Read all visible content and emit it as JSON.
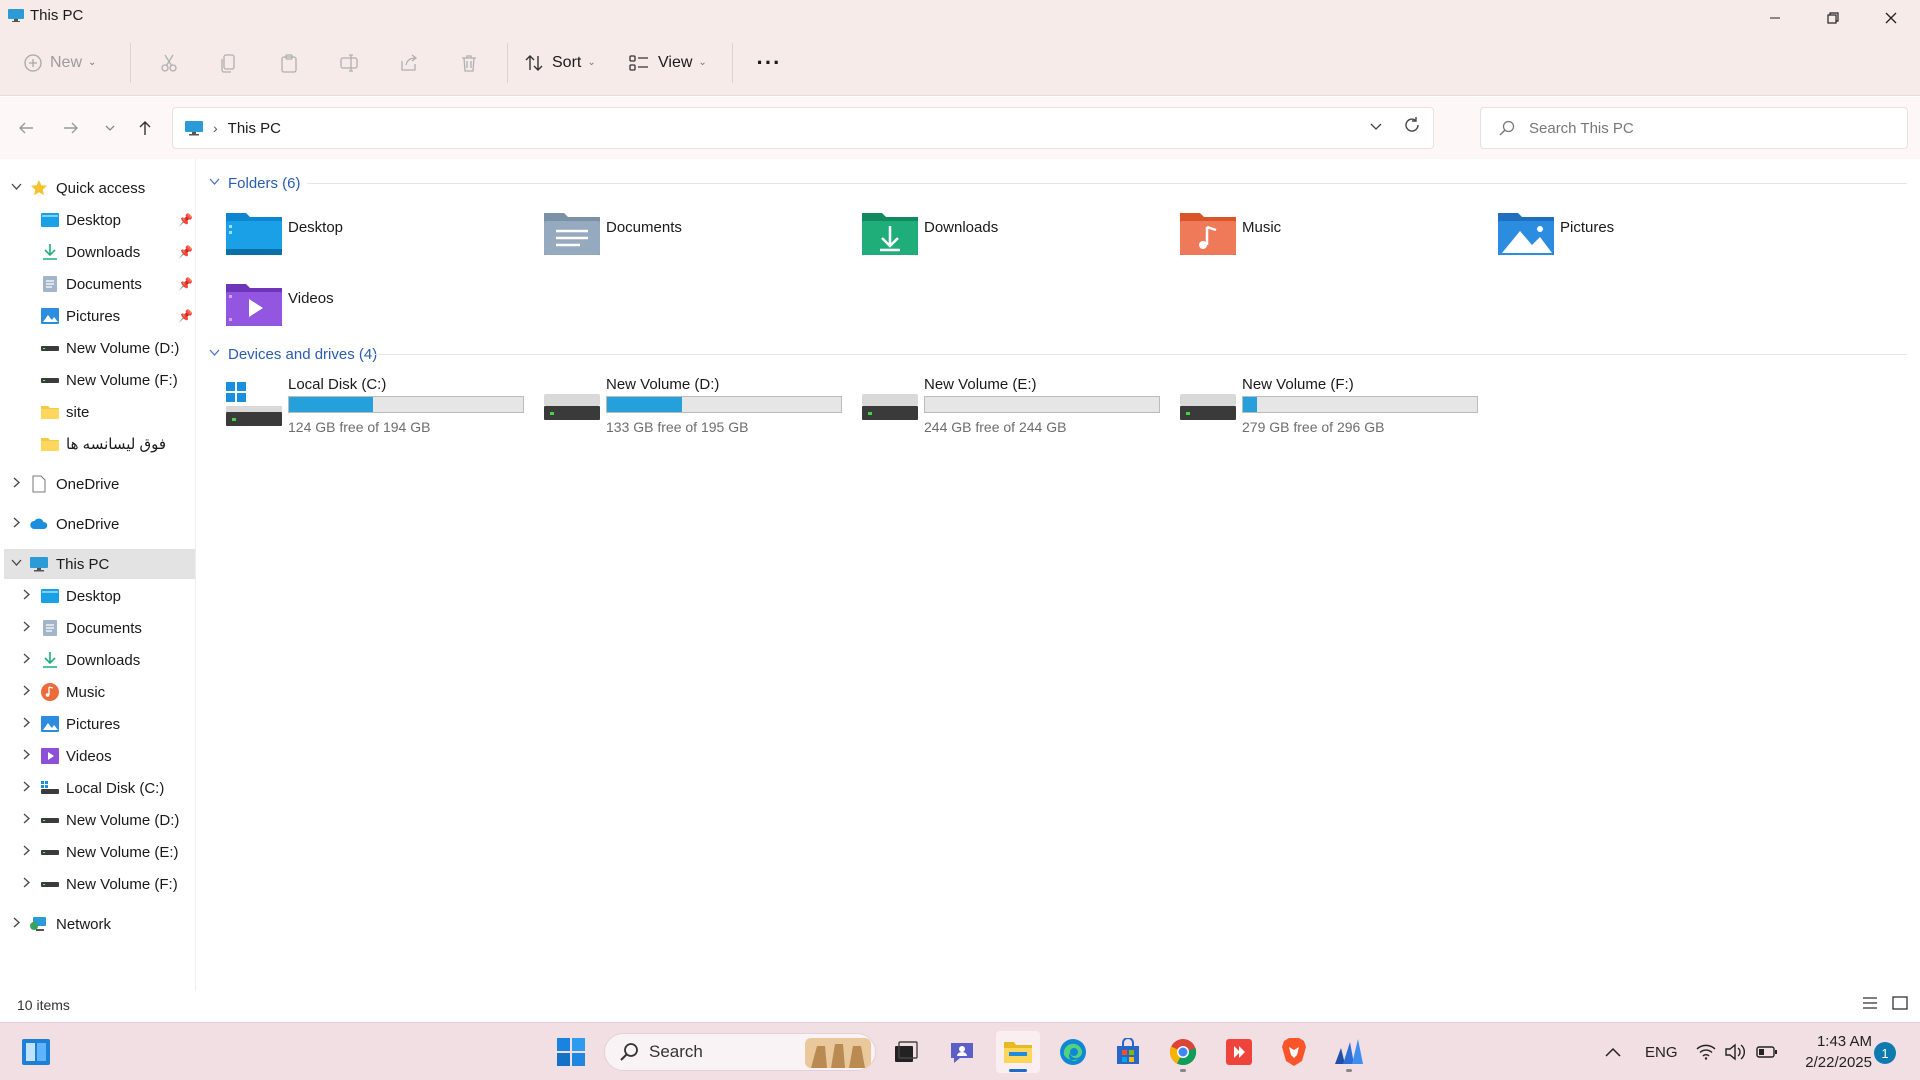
{
  "window": {
    "title": "This PC"
  },
  "toolbar": {
    "new_label": "New",
    "sort_label": "Sort",
    "view_label": "View",
    "more_label": "···"
  },
  "address": {
    "location": "This PC",
    "separator": "›"
  },
  "search": {
    "placeholder": "Search This PC"
  },
  "sidebar": {
    "quick_access": {
      "label": "Quick access",
      "items": [
        "Desktop",
        "Downloads",
        "Documents",
        "Pictures",
        "New Volume (D:)",
        "New Volume (F:)",
        "site",
        "فوق لیسانسه ها"
      ]
    },
    "onedrive_personal": "OneDrive",
    "onedrive": "OneDrive",
    "this_pc": {
      "label": "This PC",
      "items": [
        "Desktop",
        "Documents",
        "Downloads",
        "Music",
        "Pictures",
        "Videos",
        "Local Disk (C:)",
        "New Volume (D:)",
        "New Volume (E:)",
        "New Volume (F:)"
      ]
    },
    "network": "Network"
  },
  "folders": {
    "header": "Folders (6)",
    "items": [
      {
        "name": "Desktop",
        "color": "#1aa0e6"
      },
      {
        "name": "Documents",
        "color": "#8aa3bd"
      },
      {
        "name": "Downloads",
        "color": "#1fae7a"
      },
      {
        "name": "Music",
        "color": "#ec6b3b"
      },
      {
        "name": "Pictures",
        "color": "#2b8ce0"
      },
      {
        "name": "Videos",
        "color": "#8b4fd8"
      }
    ]
  },
  "drives": {
    "header": "Devices and drives (4)",
    "items": [
      {
        "name": "Local Disk (C:)",
        "free": "124 GB free of 194 GB",
        "used_fraction": 0.36
      },
      {
        "name": "New Volume (D:)",
        "free": "133 GB free of 195 GB",
        "used_fraction": 0.32
      },
      {
        "name": "New Volume (E:)",
        "free": "244 GB free of 244 GB",
        "used_fraction": 0.0
      },
      {
        "name": "New Volume (F:)",
        "free": "279 GB free of 296 GB",
        "used_fraction": 0.06
      }
    ]
  },
  "status": {
    "item_count": "10 items"
  },
  "taskbar": {
    "search_label": "Search",
    "language": "ENG",
    "time": "1:43 AM",
    "date": "2/22/2025",
    "notification_count": "1"
  },
  "colors": {
    "accent": "#26a0da",
    "title_bar": "#f6ebe8",
    "taskbar": "#f2dfe3",
    "group_header": "#2a5db0"
  }
}
